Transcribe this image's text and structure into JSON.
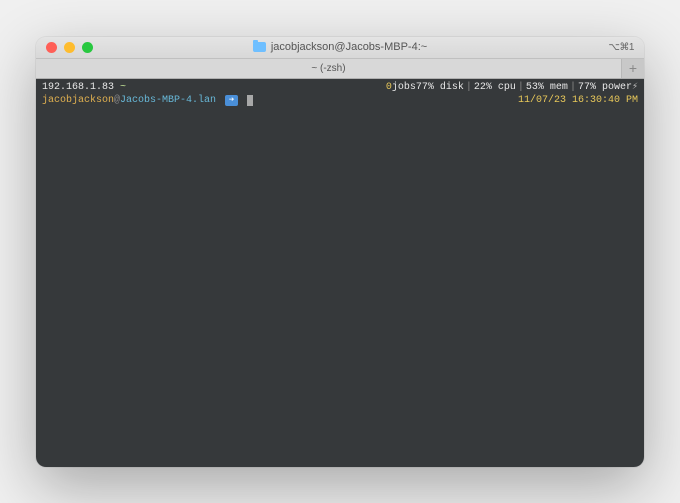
{
  "titlebar": {
    "title": "jacobjackson@Jacobs-MBP-4:~",
    "shortcut": "⌥⌘1"
  },
  "tabbar": {
    "tab_label": "~ (-zsh)",
    "add_label": "+"
  },
  "terminal": {
    "line1_left": {
      "ip": "192.168.1.83",
      "path": "~"
    },
    "line1_right": {
      "jobs_count": "0",
      "jobs_label": " jobs ",
      "disk": "77% disk",
      "cpu": "22% cpu",
      "mem": "53%  mem",
      "power": "77% power",
      "bolt": "⚡︎"
    },
    "line2_left": {
      "user": "jacobjackson",
      "at": "@",
      "host": "Jacobs-MBP-4.lan",
      "arrow": "➔"
    },
    "line2_right": {
      "timestamp": "11/07/23 16:30:40 PM"
    }
  }
}
